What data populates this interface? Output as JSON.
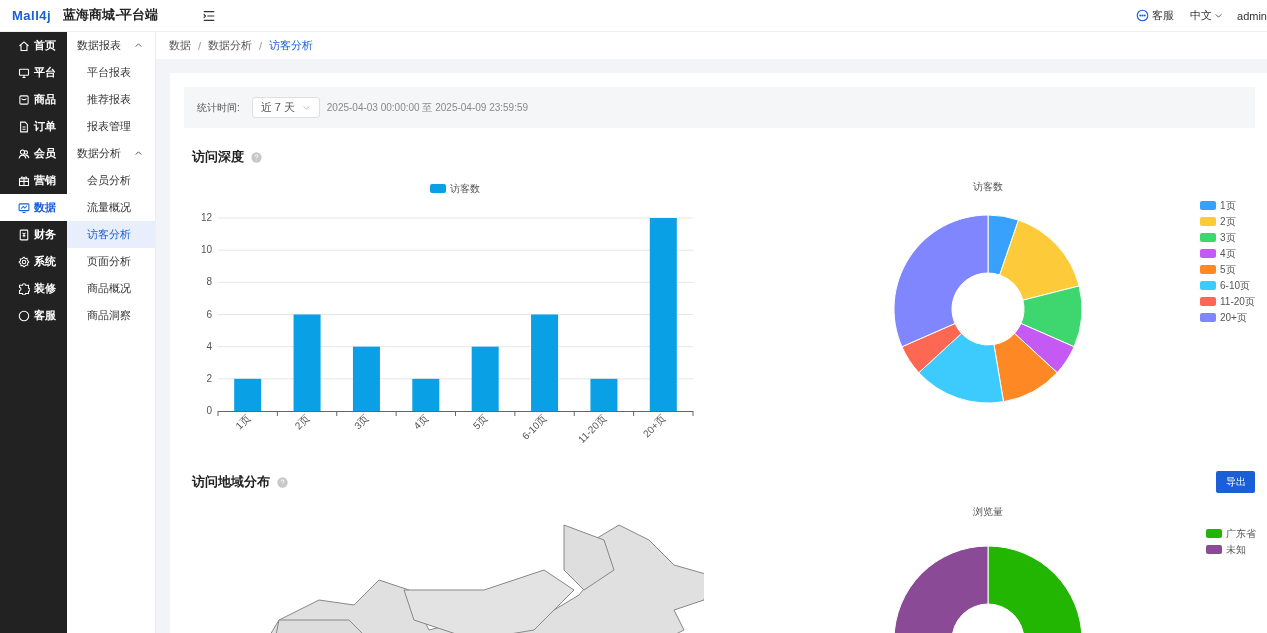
{
  "header": {
    "logo": "Mall4j",
    "title": "蓝海商城-平台端",
    "support": "客服",
    "language": "中文",
    "user": "admin"
  },
  "main_menu": [
    {
      "label": "首页",
      "selected": false
    },
    {
      "label": "平台",
      "selected": false
    },
    {
      "label": "商品",
      "selected": false
    },
    {
      "label": "订单",
      "selected": false
    },
    {
      "label": "会员",
      "selected": false
    },
    {
      "label": "营销",
      "selected": false
    },
    {
      "label": "数据",
      "selected": true
    },
    {
      "label": "财务",
      "selected": false
    },
    {
      "label": "系统",
      "selected": false
    },
    {
      "label": "装修",
      "selected": false
    },
    {
      "label": "客服",
      "selected": false
    }
  ],
  "sub_menu": [
    {
      "label": "数据报表",
      "expanded": true,
      "children": [
        {
          "label": "平台报表",
          "selected": false
        },
        {
          "label": "推荐报表",
          "selected": false
        },
        {
          "label": "报表管理",
          "selected": false
        }
      ]
    },
    {
      "label": "数据分析",
      "expanded": true,
      "children": [
        {
          "label": "会员分析",
          "selected": false
        },
        {
          "label": "流量概况",
          "selected": false
        },
        {
          "label": "访客分析",
          "selected": true
        },
        {
          "label": "页面分析",
          "selected": false
        },
        {
          "label": "商品概况",
          "selected": false
        },
        {
          "label": "商品洞察",
          "selected": false
        }
      ]
    }
  ],
  "breadcrumb": {
    "separator": "/",
    "items": [
      "数据",
      "数据分析",
      "访客分析"
    ]
  },
  "filter": {
    "label": "统计时间:",
    "period": "近 7 天",
    "range": "2025-04-03 00:00:00 至 2025-04-09 23:59:59"
  },
  "depth_section": {
    "title": "访问深度",
    "bar_chart": {
      "chart_data": {
        "type": "bar",
        "grid": true,
        "legend": "top",
        "categories": [
          "1页",
          "2页",
          "3页",
          "4页",
          "5页",
          "6-10页",
          "11-20页",
          "20+页"
        ],
        "ylim": [
          0,
          12
        ],
        "yticks": [
          0,
          2,
          4,
          6,
          8,
          10,
          12
        ],
        "series": [
          {
            "name": "访客数",
            "color": "#0aa0e6",
            "values": [
              2,
              6,
              4,
              2,
              4,
              6,
              2,
              12
            ]
          }
        ]
      }
    },
    "donut_chart": {
      "chart_data": {
        "type": "donut",
        "title": "访客数",
        "legend": "right",
        "categories": [
          "1页",
          "2页",
          "3页",
          "4页",
          "5页",
          "6-10页",
          "11-20页",
          "20+页"
        ],
        "series": [
          {
            "values": [
              2,
              6,
              4,
              2,
              4,
              6,
              2,
              12
            ]
          }
        ],
        "colors": [
          "#38a1fb",
          "#fdcb3a",
          "#3ed66e",
          "#c45af3",
          "#fd8824",
          "#3dcbfd",
          "#fc6853",
          "#8087fe"
        ]
      }
    }
  },
  "region_section": {
    "title": "访问地域分布",
    "export_button": "导出",
    "donut_chart": {
      "chart_data": {
        "type": "donut",
        "title": "浏览量",
        "legend": "right",
        "categories": [
          "广东省",
          "未知"
        ],
        "series": [
          {
            "values": [
              50,
              50
            ]
          }
        ],
        "colors": [
          "#22b602",
          "#8b4a96"
        ]
      }
    }
  }
}
